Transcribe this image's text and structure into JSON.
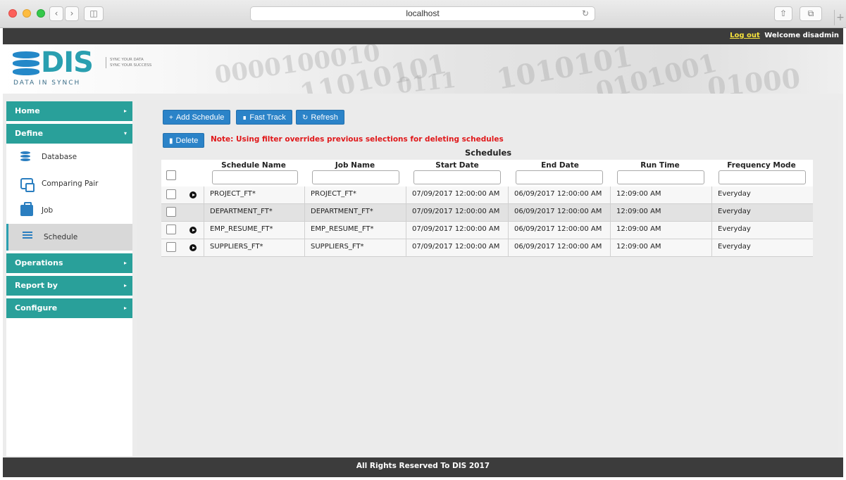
{
  "browser": {
    "url": "localhost"
  },
  "topbar": {
    "logout": "Log out",
    "welcome": "Welcome disadmin"
  },
  "logo": {
    "name": "DIS",
    "subtitle": "DATA IN SYNCH",
    "tag1": "SYNC YOUR DATA",
    "tag2": "SYNC YOUR SUCCESS"
  },
  "sidebar": {
    "home": "Home",
    "define": "Define",
    "define_items": [
      "Database",
      "Comparing Pair",
      "Job",
      "Schedule"
    ],
    "operations": "Operations",
    "report_by": "Report by",
    "configure": "Configure"
  },
  "toolbar": {
    "add": "Add Schedule",
    "fast_track": "Fast Track",
    "refresh": "Refresh",
    "delete": "Delete"
  },
  "note": "Note: Using filter overrides previous selections for deleting schedules",
  "table": {
    "title": "Schedules",
    "columns": [
      "Schedule Name",
      "Job Name",
      "Start Date",
      "End Date",
      "Run Time",
      "Frequency Mode"
    ],
    "rows": [
      {
        "schedule": "PROJECT_FT*",
        "job": "PROJECT_FT*",
        "start": "07/09/2017 12:00:00 AM",
        "end": "06/09/2017 12:00:00 AM",
        "run": "12:09:00 AM",
        "freq": "Everyday"
      },
      {
        "schedule": "DEPARTMENT_FT*",
        "job": "DEPARTMENT_FT*",
        "start": "07/09/2017 12:00:00 AM",
        "end": "06/09/2017 12:00:00 AM",
        "run": "12:09:00 AM",
        "freq": "Everyday"
      },
      {
        "schedule": "EMP_RESUME_FT*",
        "job": "EMP_RESUME_FT*",
        "start": "07/09/2017 12:00:00 AM",
        "end": "06/09/2017 12:00:00 AM",
        "run": "12:09:00 AM",
        "freq": "Everyday"
      },
      {
        "schedule": "SUPPLIERS_FT*",
        "job": "SUPPLIERS_FT*",
        "start": "07/09/2017 12:00:00 AM",
        "end": "06/09/2017 12:00:00 AM",
        "run": "12:09:00 AM",
        "freq": "Everyday"
      }
    ]
  },
  "footer": "All Rights Reserved To DIS 2017"
}
